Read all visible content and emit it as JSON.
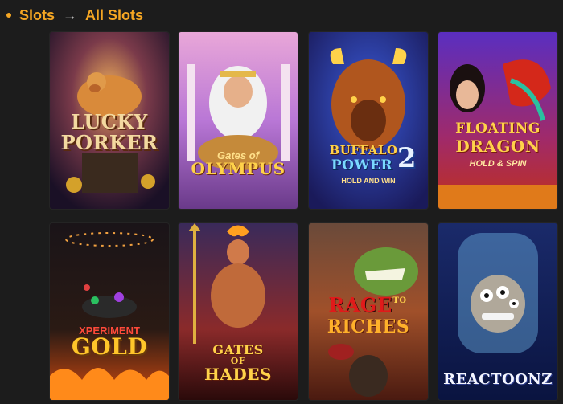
{
  "breadcrumb": {
    "root": "Slots",
    "current": "All Slots"
  },
  "games": [
    {
      "id": "lucky-porker",
      "title_line1": "LUCKY",
      "title_line2": "PORKER"
    },
    {
      "id": "gates-of-olympus",
      "title_line1": "Gates of",
      "title_line2": "OLYMPUS"
    },
    {
      "id": "buffalo-power-2",
      "title_line1": "BUFFALO",
      "title_line2": "POWER",
      "badge": "2",
      "subtitle": "HOLD AND WIN"
    },
    {
      "id": "floating-dragon",
      "title_line1": "FLOATING",
      "title_line2": "DRAGON",
      "subtitle": "HOLD & SPIN"
    },
    {
      "id": "xperiment-gold",
      "title_line1": "XPERIMENT",
      "title_line2": "GOLD"
    },
    {
      "id": "gates-of-hades",
      "title_line1": "GATES",
      "title_line2": "OF",
      "title_line3": "HADES"
    },
    {
      "id": "rage-to-riches",
      "title_line1": "RAGE",
      "title_small": "TO",
      "title_line2": "RICHES"
    },
    {
      "id": "reactoonz",
      "title_line1": "REACTOONZ"
    }
  ],
  "colors": {
    "accent": "#f5a623",
    "background": "#1c1c1c"
  }
}
